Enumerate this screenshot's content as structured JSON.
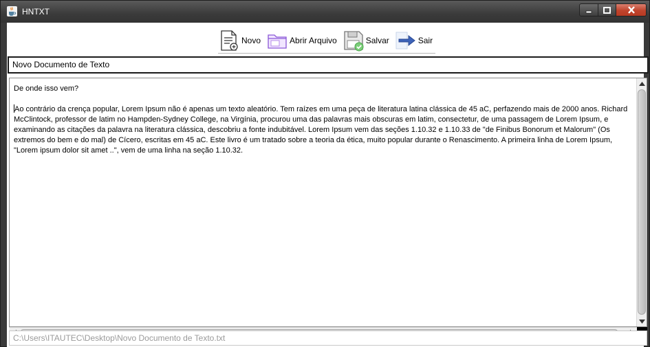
{
  "window": {
    "title": "HNTXT"
  },
  "toolbar": {
    "items": [
      {
        "label": "Novo",
        "icon": "new-document-icon"
      },
      {
        "label": "Abrir Arquivo",
        "icon": "open-folder-icon"
      },
      {
        "label": "Salvar",
        "icon": "save-disk-icon"
      },
      {
        "label": "Sair",
        "icon": "exit-arrow-icon"
      }
    ]
  },
  "document": {
    "name": "Novo Documento de Texto",
    "heading_line": "De onde isso vem?",
    "body": "Ao contrário da crença popular, Lorem Ipsum não é apenas um texto aleatório. Tem raízes em uma peça de literatura latina clássica de 45 aC, perfazendo mais de 2000 anos. Richard McClintock, professor de latim no Hampden-Sydney College, na Virgínia, procurou uma das palavras mais obscuras em latim, consectetur, de uma passagem de Lorem Ipsum, e examinando as citações da palavra na literatura clássica, descobriu a fonte indubitável. Lorem Ipsum vem das seções 1.10.32 e 1.10.33 de \"de Finibus Bonorum et Malorum\" (Os extremos do bem e do mal) de Cícero, escritas em 45 aC. Este livro é um tratado sobre a teoria da ética, muito popular durante o Renascimento. A primeira linha de Lorem Ipsum, \"Lorem ipsum dolor sit amet ..\", vem de uma linha na seção 1.10.32.",
    "path": "C:\\Users\\ITAUTEC\\Desktop\\Novo Documento de Texto.txt"
  },
  "colors": {
    "titlebar": "#3b3b3b",
    "close_button": "#c0442d",
    "path_text": "#9a9a9a"
  }
}
